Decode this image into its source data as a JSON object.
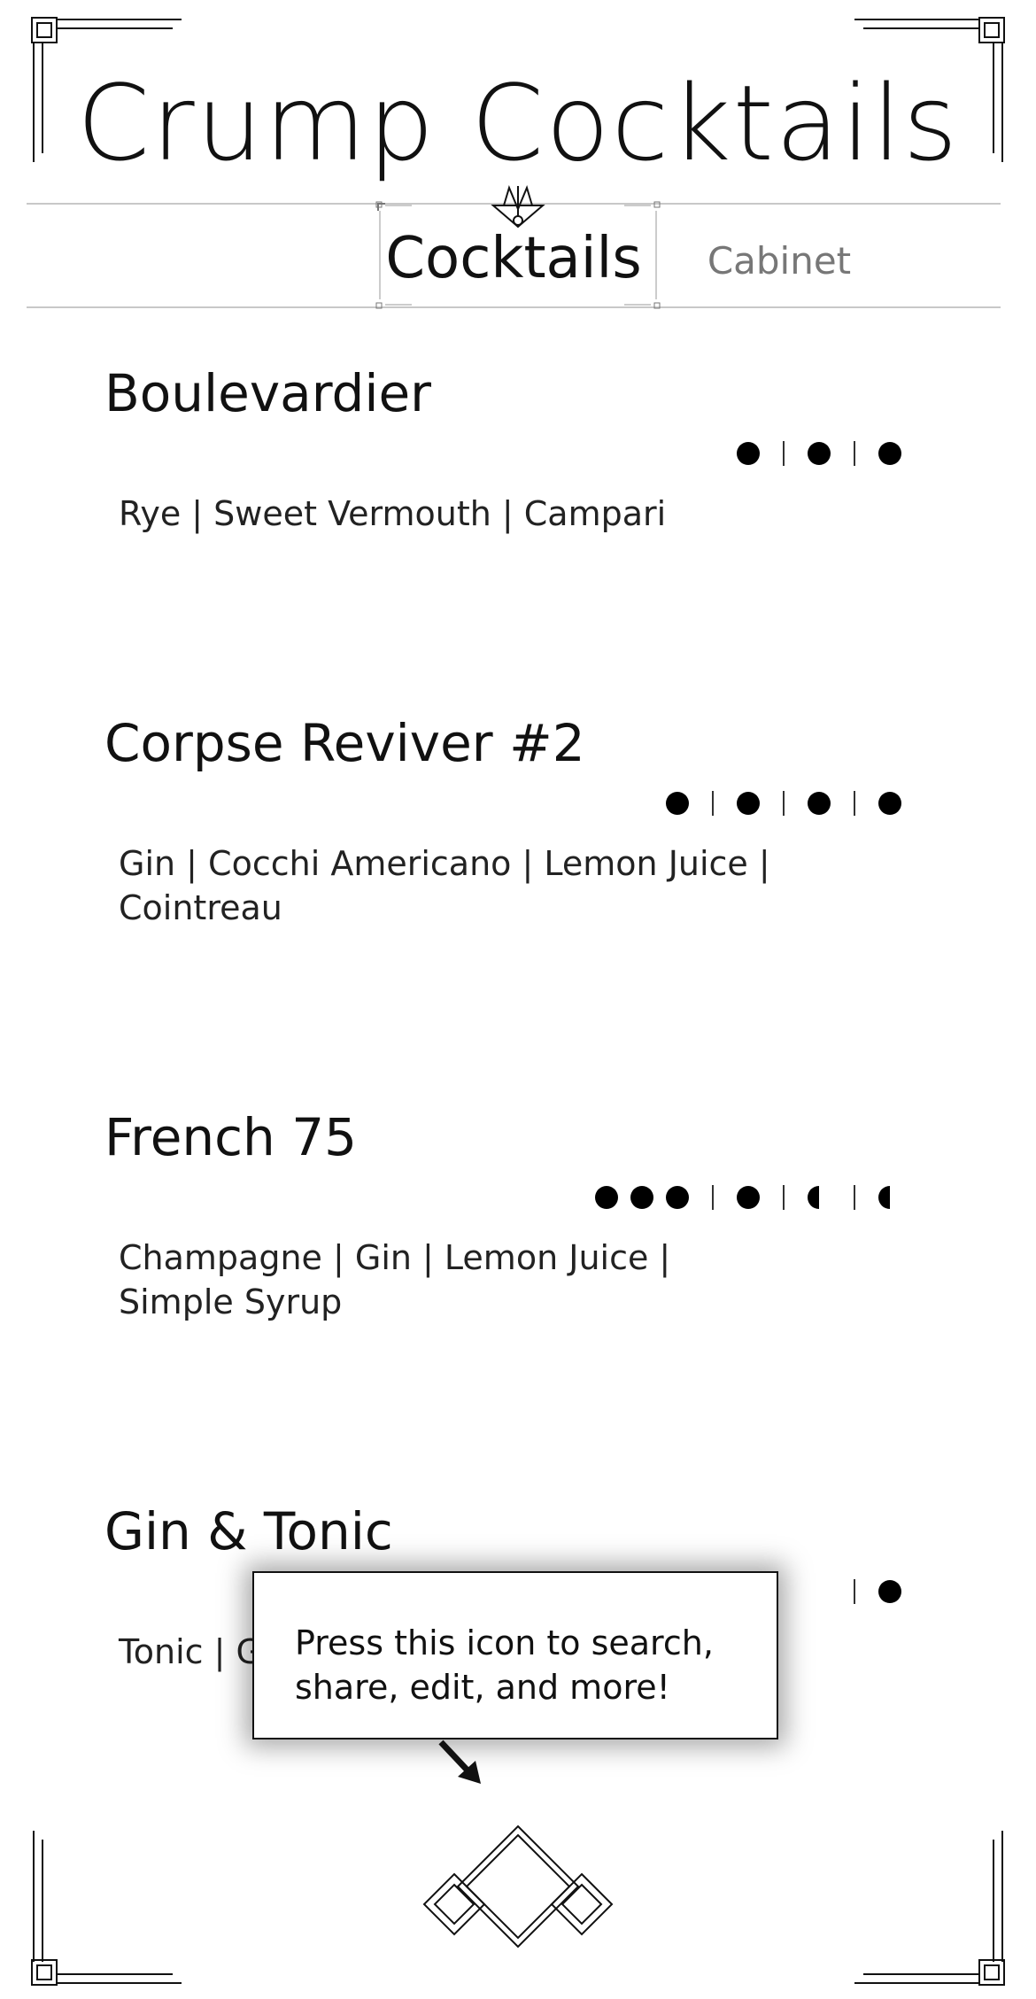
{
  "app": {
    "title": "Crump Cocktails"
  },
  "tabs": [
    {
      "label": "Cocktails",
      "active": true
    },
    {
      "label": "Cabinet",
      "active": false
    }
  ],
  "cocktails": [
    {
      "name": "Boulevardier",
      "ingredients": "Rye | Sweet Vermouth | Campari",
      "strength": [
        "full",
        "sep",
        "full",
        "sep",
        "full"
      ]
    },
    {
      "name": "Corpse Reviver #2",
      "ingredients": "Gin | Cocchi Americano | Lemon Juice | Cointreau",
      "strength": [
        "full",
        "sep",
        "full",
        "sep",
        "full",
        "sep",
        "full"
      ]
    },
    {
      "name": "French 75",
      "ingredients": "Champagne | Gin | Lemon Juice | Simple Syrup",
      "strength": [
        "full",
        "full",
        "full",
        "sep",
        "full",
        "sep",
        "half",
        "sep",
        "half"
      ]
    },
    {
      "name": "Gin & Tonic",
      "ingredients": "Tonic | Gin",
      "strength": [
        "sep",
        "full"
      ]
    }
  ],
  "tooltip": {
    "text": "Press this icon to search, share, edit, and more!"
  },
  "icons": {
    "menu": "art-deco-diamond-icon",
    "corners": "art-deco-corner-icon",
    "fan": "art-deco-fan-icon"
  },
  "colors": {
    "background": "#ffffff",
    "text": "#111111",
    "rule": "#c8c8c8",
    "inactive_tab": "#777777"
  }
}
